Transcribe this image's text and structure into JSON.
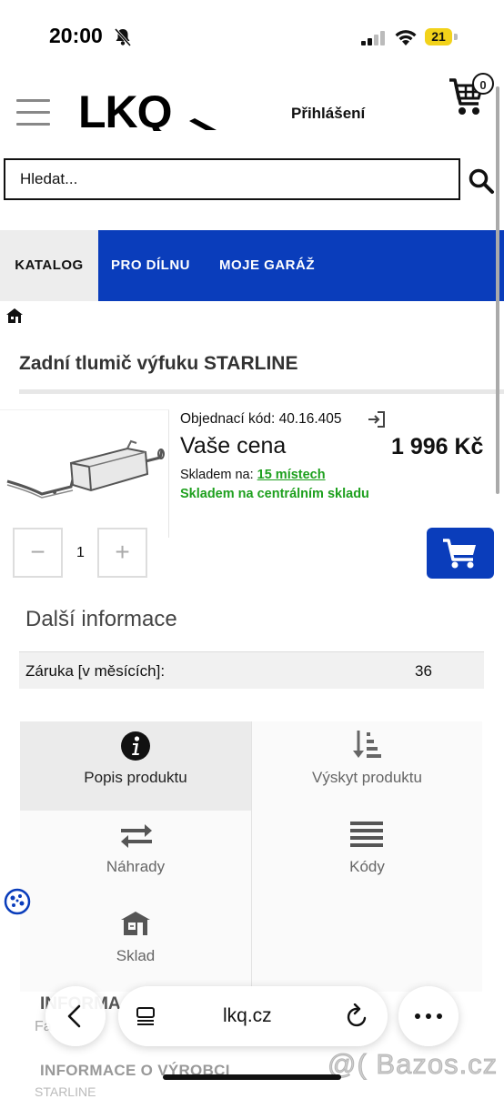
{
  "status_bar": {
    "time": "20:00",
    "battery": "21"
  },
  "header": {
    "brand": "LKQ",
    "login": "Přihlášení",
    "cart_count": "0"
  },
  "search": {
    "placeholder": "Hledat..."
  },
  "nav": {
    "tabs": [
      "KATALOG",
      "PRO DÍLNU",
      "MOJE GARÁŽ"
    ],
    "active_tab": "KATALOG"
  },
  "product": {
    "title": "Zadní tlumič výfuku STARLINE",
    "order_code": "Objednací kód: 40.16.405",
    "price_label": "Vaše cena",
    "price": "1 996 Kč",
    "stock_prefix": "Skladem na:",
    "stock_link": "15 místech",
    "stock_central": "Skladem na centrálním skladu",
    "quantity": "1",
    "minus": "−",
    "plus": "+"
  },
  "more_info": {
    "heading": "Další informace",
    "rows": [
      {
        "label": "Záruka [v měsících]:",
        "value": "36"
      }
    ]
  },
  "tiles": [
    {
      "label": "Popis produktu",
      "icon": "info-icon"
    },
    {
      "label": "Výskyt produktu",
      "icon": "sort-list-icon"
    },
    {
      "label": "Náhrady",
      "icon": "swap-arrows-icon"
    },
    {
      "label": "Kódy",
      "icon": "list-lines-icon"
    },
    {
      "label": "Sklad",
      "icon": "warehouse-icon"
    }
  ],
  "below": {
    "faded_heading": "INFORMA",
    "faded_sub": "Fa",
    "manufacturer_heading": "INFORMACE O VÝROBCI",
    "manufacturer_name": "STARLINE"
  },
  "browser": {
    "url": "lkq.cz"
  },
  "watermark": "@( Bazos.cz",
  "colors": {
    "brand_blue": "#0a3dbb",
    "stock_green": "#1ea01e",
    "battery_yellow": "#f2d21a"
  }
}
